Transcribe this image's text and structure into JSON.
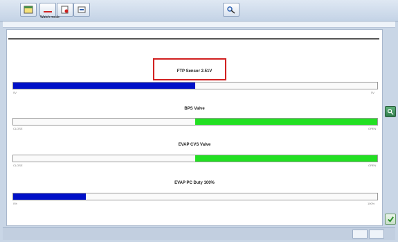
{
  "toolbar": {
    "label": "Watch mode",
    "buttons": [
      {
        "name": "calendar-icon"
      },
      {
        "name": "chart-icon"
      },
      {
        "name": "report-icon"
      },
      {
        "name": "export-icon"
      }
    ],
    "center_icon": "zoom-icon"
  },
  "gauges": [
    {
      "title": "FTP Sensor 2.51V",
      "min": "0V",
      "max": "5V",
      "percent": 50,
      "fill_side": "left",
      "color": "#0010c8",
      "highlighted": true
    },
    {
      "title": "BPS Valve",
      "min": "CLOSE",
      "max": "OPEN",
      "percent": 50,
      "fill_side": "right",
      "color": "#22e022",
      "highlighted": false
    },
    {
      "title": "EVAP CVS Valve",
      "min": "CLOSE",
      "max": "OPEN",
      "percent": 50,
      "fill_side": "right",
      "color": "#22e022",
      "highlighted": false
    },
    {
      "title": "EVAP PC Duty 100%",
      "min": "0%",
      "max": "100%",
      "percent": 20,
      "fill_side": "left",
      "color": "#0010c8",
      "highlighted": false
    }
  ],
  "side": {
    "magnifier_icon": "magnifier-icon",
    "ok_icon": "check-icon"
  }
}
